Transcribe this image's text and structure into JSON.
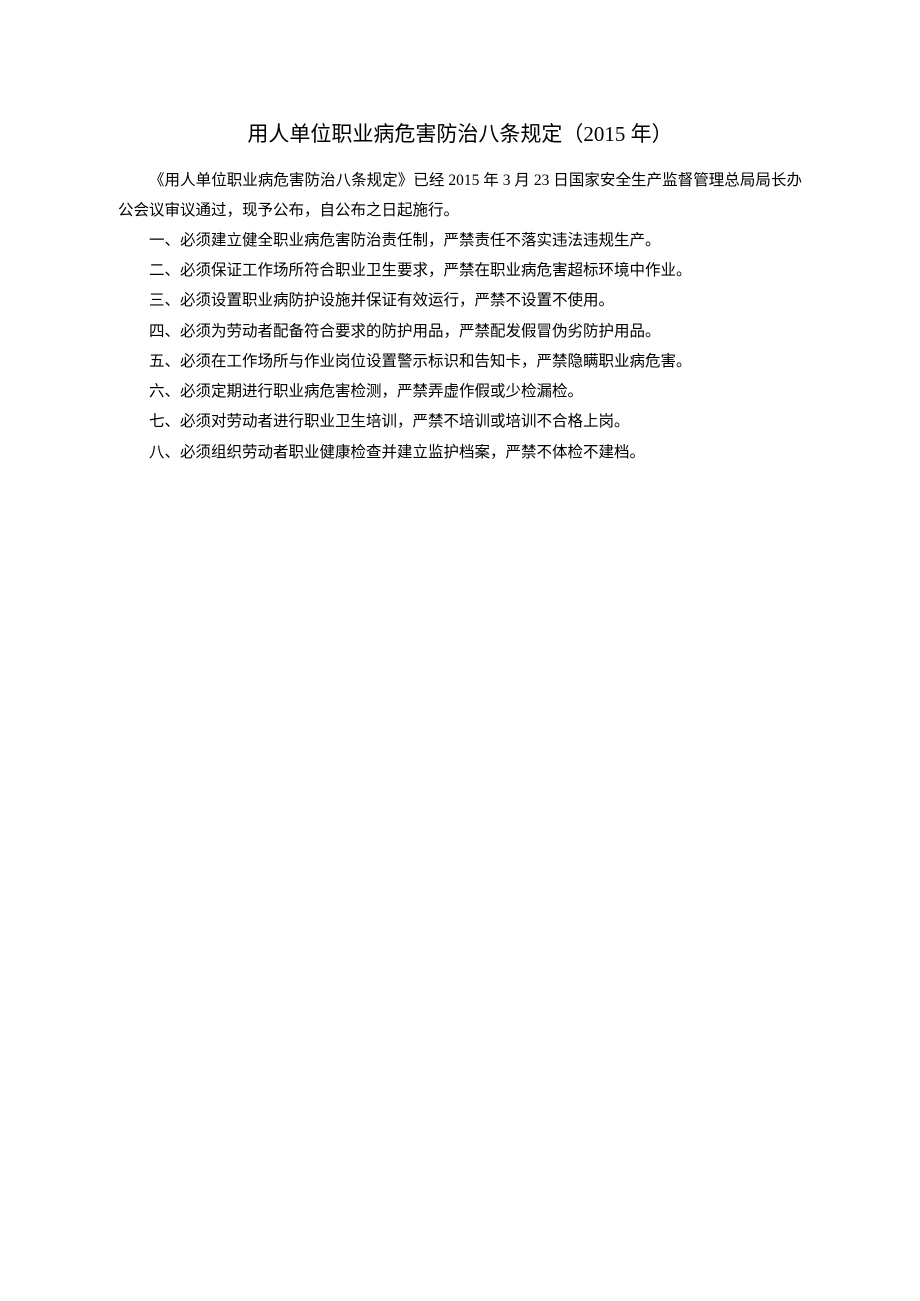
{
  "title": "用人单位职业病危害防治八条规定（2015 年）",
  "intro": "《用人单位职业病危害防治八条规定》已经 2015 年 3 月 23 日国家安全生产监督管理总局局长办公会议审议通过，现予公布，自公布之日起施行。",
  "items": [
    "一、必须建立健全职业病危害防治责任制，严禁责任不落实违法违规生产。",
    "二、必须保证工作场所符合职业卫生要求，严禁在职业病危害超标环境中作业。",
    "三、必须设置职业病防护设施并保证有效运行，严禁不设置不使用。",
    "四、必须为劳动者配备符合要求的防护用品，严禁配发假冒伪劣防护用品。",
    "五、必须在工作场所与作业岗位设置警示标识和告知卡，严禁隐瞒职业病危害。",
    "六、必须定期进行职业病危害检测，严禁弄虚作假或少检漏检。",
    "七、必须对劳动者进行职业卫生培训，严禁不培训或培训不合格上岗。",
    "八、必须组织劳动者职业健康检查并建立监护档案，严禁不体检不建档。"
  ]
}
